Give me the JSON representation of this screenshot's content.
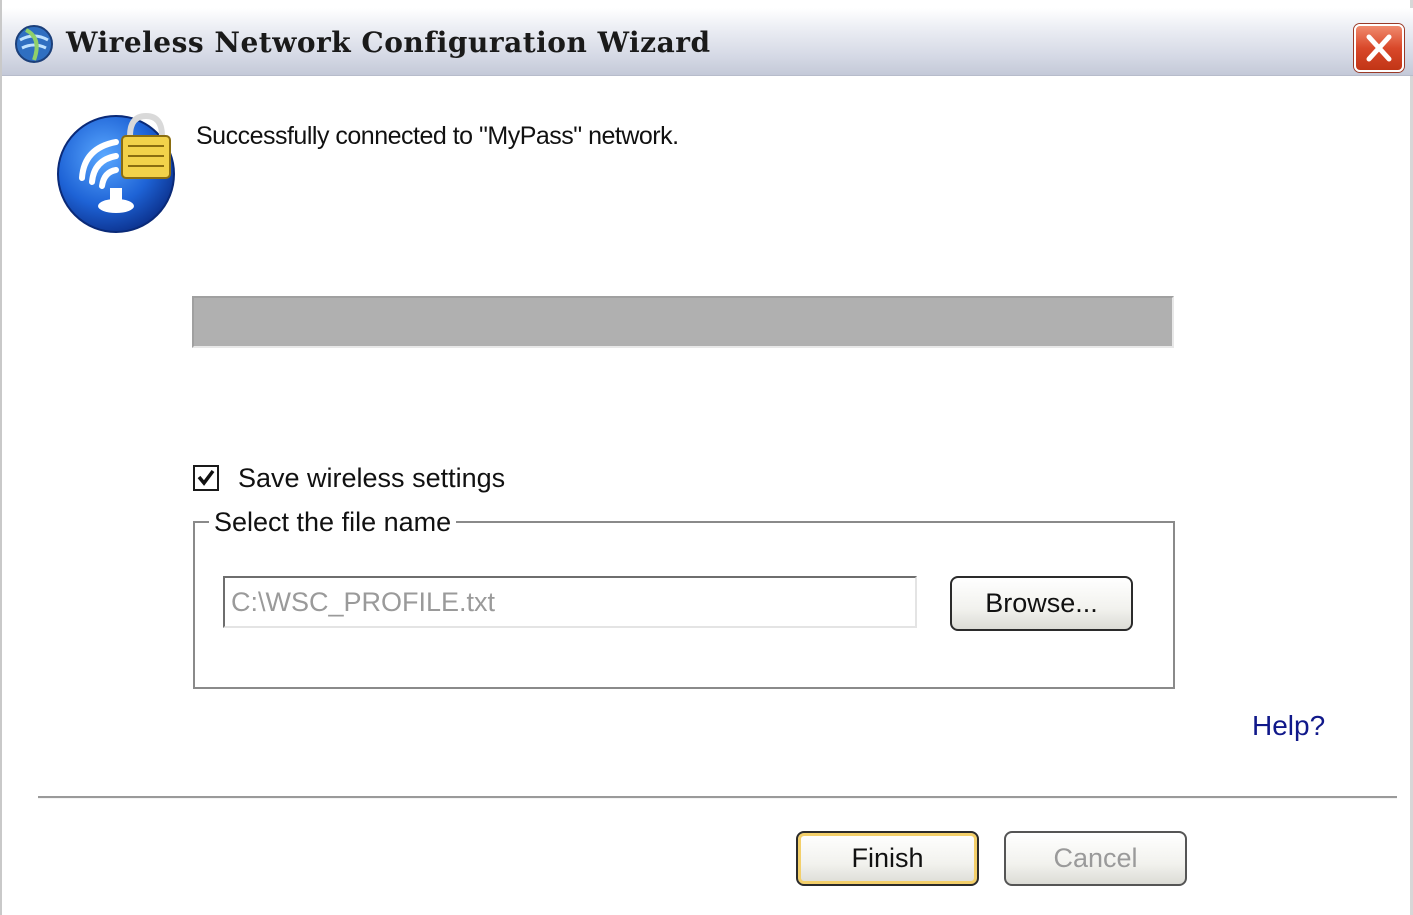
{
  "window": {
    "title": "Wireless Network Configuration Wizard"
  },
  "icons": {
    "title": "globe-icon",
    "close": "close-icon",
    "hero": "wireless-lock-icon",
    "check": "checkmark-icon"
  },
  "status": {
    "message": "Successfully connected to \"MyPass\" network."
  },
  "save": {
    "label": "Save wireless settings",
    "checked": true
  },
  "file_group": {
    "legend": "Select the file name",
    "path_value": "C:\\WSC_PROFILE.txt",
    "browse_label": "Browse..."
  },
  "help": {
    "label": "Help?"
  },
  "footer": {
    "finish_label": "Finish",
    "cancel_label": "Cancel"
  },
  "colors": {
    "title_gradient_bottom": "#c4c9d8",
    "close_red": "#d9482a",
    "progress_gray": "#b0b0b0",
    "help_link": "#10188a",
    "finish_focus": "#f3cf6a"
  }
}
